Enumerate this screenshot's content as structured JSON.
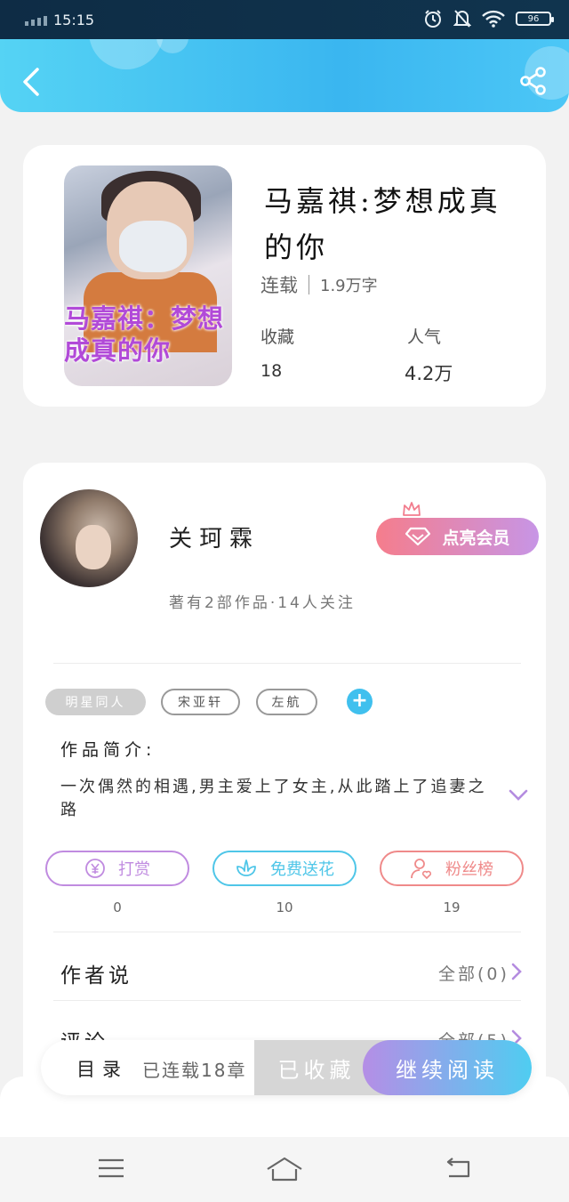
{
  "status_bar": {
    "time": "15:15",
    "battery": "96",
    "icons": [
      "signal-icon",
      "alarm-icon",
      "bell-off-icon",
      "wifi-icon",
      "battery-icon"
    ]
  },
  "header": {
    "back_icon": "back-arrow-icon",
    "share_icon": "share-icon",
    "gradient": [
      "#55d3f4",
      "#3ab6f0"
    ]
  },
  "book": {
    "cover_text": "马嘉祺：梦想成真的你",
    "title": "马嘉祺:梦想成真的你",
    "status": "连载",
    "word_count": "1.9万字",
    "favorites_label": "收藏",
    "favorites_value": "18",
    "popularity_label": "人气",
    "popularity_value": "4.2万"
  },
  "author": {
    "name": "关珂霖",
    "stats": "著有2部作品·14人关注",
    "vip_button": "点亮会员"
  },
  "tags": [
    "明星同人",
    "宋亚轩",
    "左航"
  ],
  "intro": {
    "heading": "作品简介:",
    "text": "一次偶然的相遇,男主爱上了女主,从此踏上了追妻之路"
  },
  "actions": [
    {
      "label": "打赏",
      "count": "0",
      "icon": "yen-icon",
      "color": "#c08be0"
    },
    {
      "label": "免费送花",
      "count": "10",
      "icon": "flower-icon",
      "color": "#4fc6e8"
    },
    {
      "label": "粉丝榜",
      "count": "19",
      "icon": "fan-rank-icon",
      "color": "#ef8a8a"
    }
  ],
  "sections": [
    {
      "title": "作者说",
      "right": "全部(0)"
    },
    {
      "title": "评论",
      "right": "全部(5)"
    }
  ],
  "bottom_bar": {
    "toc": "目录",
    "serial": "已连载18章",
    "favorited": "已收藏",
    "continue": "继续阅读"
  },
  "nav": [
    "menu-icon",
    "home-icon",
    "back-icon"
  ]
}
